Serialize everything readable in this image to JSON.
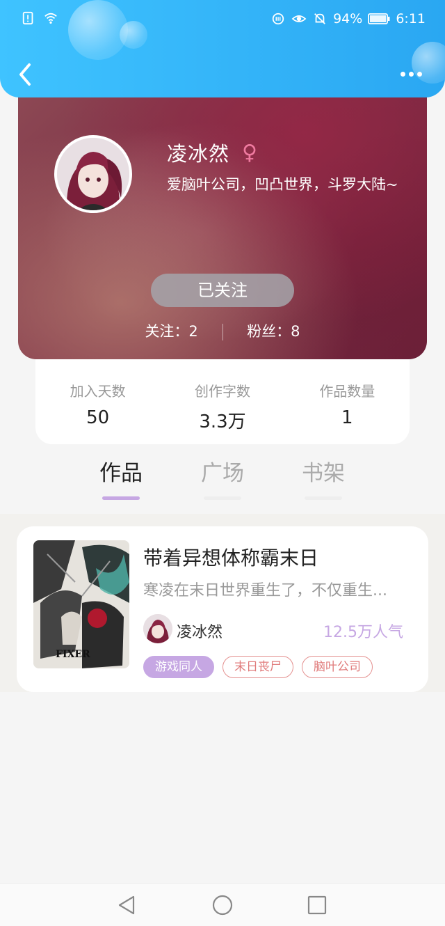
{
  "status_bar": {
    "battery_percent": "94%",
    "time": "6:11"
  },
  "profile": {
    "username": "凌冰然",
    "gender_symbol": "♀",
    "bio": "爱脑叶公司，凹凸世界，斗罗大陆~",
    "follow_button": "已关注",
    "following": "关注：2",
    "followers": "粉丝：8"
  },
  "stats": [
    {
      "label": "加入天数",
      "value": "50"
    },
    {
      "label": "创作字数",
      "value": "3.3万"
    },
    {
      "label": "作品数量",
      "value": "1"
    }
  ],
  "tabs": [
    {
      "label": "作品",
      "active": true
    },
    {
      "label": "广场",
      "active": false
    },
    {
      "label": "书架",
      "active": false
    }
  ],
  "book": {
    "title": "带着异想体称霸末日",
    "description": "寒凌在末日世界重生了，不仅重生...",
    "author": "凌冰然",
    "popularity": "12.5万人气",
    "cover_text": "FIXER",
    "tags": [
      {
        "label": "游戏同人",
        "style": "filled"
      },
      {
        "label": "末日丧尸",
        "style": "outline"
      },
      {
        "label": "脑叶公司",
        "style": "outline"
      }
    ]
  },
  "colors": {
    "header_blue": "#2aa7f2",
    "accent_purple": "#c6a7e3",
    "tag_red": "#e07b7b",
    "gender_pink": "#f07aa0"
  },
  "icons": [
    "back-icon",
    "more-icon",
    "female-icon",
    "nav-back-icon",
    "nav-home-icon",
    "nav-recents-icon"
  ]
}
